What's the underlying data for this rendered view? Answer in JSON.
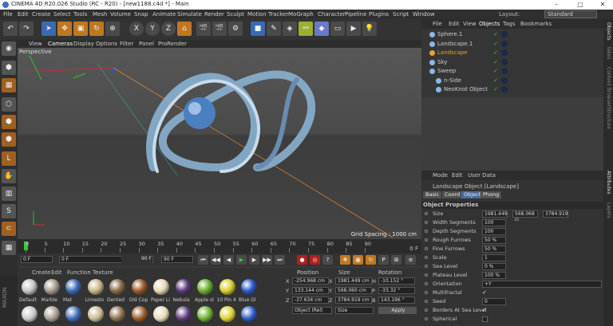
{
  "window": {
    "title": "CINEMA 4D R20.026 Studio (RC - R20) - [new1188.c4d *] - Main"
  },
  "menu": [
    "File",
    "Edit",
    "Create",
    "Select",
    "Tools",
    "Mesh",
    "Volume",
    "Snap",
    "Animate",
    "Simulate",
    "Render",
    "Sculpt",
    "Motion Tracker",
    "MoGraph",
    "Character",
    "Pipeline",
    "Plugins",
    "Script",
    "Window"
  ],
  "layout": {
    "label": "Layout:",
    "value": "Standard"
  },
  "toolbar": {
    "x": "X",
    "y": "Y",
    "z": "Z"
  },
  "viewport": {
    "menu": [
      "View",
      "Cameras",
      "Display",
      "Options",
      "Filter",
      "Panel",
      "ProRender"
    ],
    "label": "Perspective",
    "grid": "Grid Spacing : 1000 cm"
  },
  "timeline": {
    "ticks": [
      "0",
      "5",
      "10",
      "15",
      "20",
      "25",
      "30",
      "35",
      "40",
      "45",
      "50",
      "55",
      "60",
      "65",
      "70",
      "75",
      "80",
      "85",
      "90"
    ],
    "end": "0 F"
  },
  "transport": {
    "start": "0 F",
    "current": "0 F",
    "end": "90 F",
    "end2": "90 F"
  },
  "materials": {
    "menu": [
      "Create",
      "Edit",
      "Function",
      "Texture"
    ],
    "items": [
      {
        "name": "Default",
        "color": "#c8c8c8"
      },
      {
        "name": "Marble",
        "color": "#a89c8e"
      },
      {
        "name": "Mat",
        "color": "#3a6ab5"
      },
      {
        "name": "Limesto",
        "color": "#c9b790"
      },
      {
        "name": "Dented",
        "color": "#8a6a4a"
      },
      {
        "name": "Old Cop",
        "color": "#9c5a2a"
      },
      {
        "name": "Paper Li",
        "color": "#e8d8b8"
      },
      {
        "name": "Nebula",
        "color": "#5a3a7a"
      },
      {
        "name": "Apple sl",
        "color": "#6ab030"
      },
      {
        "name": "10 Pin 4",
        "color": "#d8d030"
      },
      {
        "name": "Blue Gl",
        "color": "#2a5ac8"
      }
    ]
  },
  "coords": {
    "headers": [
      "Position",
      "Size",
      "Rotation"
    ],
    "rows": [
      {
        "a": "X",
        "pos": "-254.968 cm",
        "b": "X",
        "size": "1981.449 cm",
        "c": "H",
        "rot": "-10.152 °"
      },
      {
        "a": "Y",
        "pos": "133.144 cm",
        "b": "Y",
        "size": "568.060 cm",
        "c": "P",
        "rot": "-33.32 °"
      },
      {
        "a": "Z",
        "pos": "-37.634 cm",
        "b": "Z",
        "size": "3784.919 cm",
        "c": "B",
        "rot": "143.196 °"
      }
    ],
    "mode": "Object (Rel)",
    "sizemode": "Size",
    "apply": "Apply"
  },
  "objects": {
    "tabs": [
      "File",
      "Edit",
      "View",
      "Objects",
      "Tags",
      "Bookmarks"
    ],
    "items": [
      {
        "name": "Sphere.1",
        "indent": 0,
        "color": "#8ab8e8"
      },
      {
        "name": "Landscape.1",
        "indent": 0,
        "color": "#8ab8e8"
      },
      {
        "name": "Landscape",
        "indent": 0,
        "color": "#f0a030"
      },
      {
        "name": "Sky",
        "indent": 0,
        "color": "#8ab8e8"
      },
      {
        "name": "Sweep",
        "indent": 0,
        "color": "#8ab8e8"
      },
      {
        "name": "n-Side",
        "indent": 1,
        "color": "#8ab8e8"
      },
      {
        "name": "NeoKnot Object",
        "indent": 1,
        "color": "#8ab8e8"
      }
    ]
  },
  "attributes": {
    "menu": [
      "Mode",
      "Edit",
      "User Data"
    ],
    "title": "Landscape Object [Landscape]",
    "tabs": [
      "Basic",
      "Coord",
      "Object",
      "Phong"
    ],
    "section": "Object Properties",
    "props": [
      {
        "label": "Size",
        "v1": "1981.449",
        "v2": "568.068 cı",
        "v3": "3784.919"
      },
      {
        "label": "Width Segments",
        "v1": "100"
      },
      {
        "label": "Depth Segments",
        "v1": "100"
      },
      {
        "label": "Rough Furrows",
        "v1": "50 %"
      },
      {
        "label": "Fine Furrows",
        "v1": "50 %"
      },
      {
        "label": "Scale",
        "v1": "1"
      },
      {
        "label": "Sea Level",
        "v1": "0 %"
      },
      {
        "label": "Plateau Level",
        "v1": "100 %"
      },
      {
        "label": "Orientation",
        "v1": "+Y"
      },
      {
        "label": "Multifractal",
        "v1": "✓"
      },
      {
        "label": "Seed",
        "v1": "0"
      },
      {
        "label": "Borders At Sea Level",
        "v1": "✓"
      },
      {
        "label": "Spherical",
        "v1": ""
      }
    ]
  },
  "sidetabs": [
    "Objects",
    "Takes",
    "Content Browser",
    "Structure",
    "Attributes",
    "Layers"
  ]
}
